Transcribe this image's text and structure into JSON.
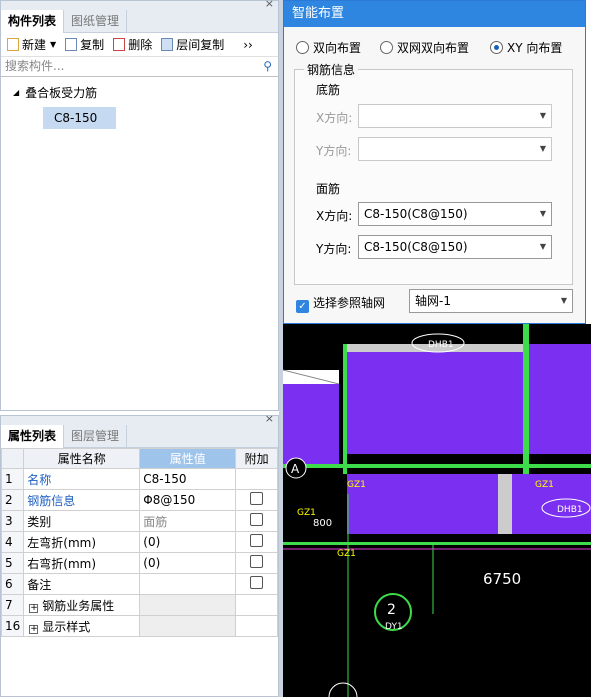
{
  "component_panel": {
    "tabs": [
      "构件列表",
      "图纸管理"
    ],
    "toolbar": {
      "new": "新建",
      "copy": "复制",
      "delete": "删除",
      "floor_copy": "层间复制",
      "more": "››"
    },
    "search_placeholder": "搜索构件...",
    "tree": {
      "parent": "叠合板受力筋",
      "child": "C8-150"
    }
  },
  "property_panel": {
    "tabs": [
      "属性列表",
      "图层管理"
    ],
    "headers": [
      "属性名称",
      "属性值",
      "附加"
    ],
    "rows": [
      {
        "num": "1",
        "name": "名称",
        "value": "C8-150"
      },
      {
        "num": "2",
        "name": "钢筋信息",
        "value": "Φ8@150"
      },
      {
        "num": "3",
        "name": "类别",
        "value": "面筋"
      },
      {
        "num": "4",
        "name": "左弯折(mm)",
        "value": "(0)"
      },
      {
        "num": "5",
        "name": "右弯折(mm)",
        "value": "(0)"
      },
      {
        "num": "6",
        "name": "备注",
        "value": ""
      },
      {
        "num": "7",
        "name": "钢筋业务属性",
        "value": ""
      },
      {
        "num": "16",
        "name": "显示样式",
        "value": ""
      }
    ]
  },
  "dialog": {
    "title": "智能布置",
    "radios": [
      "双向布置",
      "双网双向布置",
      "XY 向布置"
    ],
    "selected_radio": "XY 向布置",
    "group_title": "钢筋信息",
    "bottom_label": "底筋",
    "top_label": "面筋",
    "x_label": "X方向:",
    "y_label": "Y方向:",
    "bottom_x": "",
    "bottom_y": "",
    "top_x": "C8-150(C8@150)",
    "top_y": "C8-150(C8@150)",
    "axis_checkbox": "选择参照轴网",
    "axis_value": "轴网-1"
  },
  "cad": {
    "labels": [
      "DHB1",
      "GZ1",
      "GZ1",
      "GZ1",
      "GZ1",
      "DHB1",
      "800",
      "6750",
      "2",
      "DY1",
      "A"
    ]
  },
  "colors": {
    "accent": "#2f86e0",
    "cad_purple": "#7b2ff0",
    "cad_green": "#3ddc4a",
    "cad_magenta": "#e040e0"
  }
}
